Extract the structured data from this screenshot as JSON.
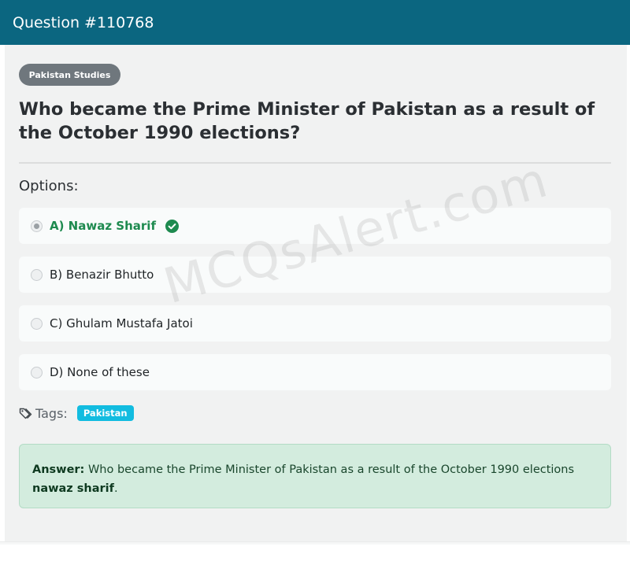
{
  "header": {
    "title": "Question #110768"
  },
  "question": {
    "category": "Pakistan Studies",
    "text": "Who became the Prime Minister of Pakistan as a result of the October 1990 elections?"
  },
  "options_heading": "Options:",
  "options": [
    {
      "label": "A) Nawaz Sharif",
      "selected": true,
      "correct": true
    },
    {
      "label": "B) Benazir Bhutto",
      "selected": false,
      "correct": false
    },
    {
      "label": "C) Ghulam Mustafa Jatoi",
      "selected": false,
      "correct": false
    },
    {
      "label": "D) None of these",
      "selected": false,
      "correct": false
    }
  ],
  "tags": {
    "label": "Tags:",
    "items": [
      "Pakistan"
    ]
  },
  "answer": {
    "prefix": "Answer:",
    "text": " Who became the Prime Minister of Pakistan as a result of the October 1990 elections ",
    "value": "nawaz sharif",
    "suffix": "."
  },
  "watermark": "MCQsAlert.com",
  "colors": {
    "header_bg": "#0b6680",
    "correct_green": "#1e8a4f",
    "tag_chip": "#12bce0",
    "answer_bg": "#d3ecde",
    "category_badge": "#6f777d"
  },
  "icons": {
    "correct": "check-circle-icon",
    "tags": "tag-icon"
  }
}
